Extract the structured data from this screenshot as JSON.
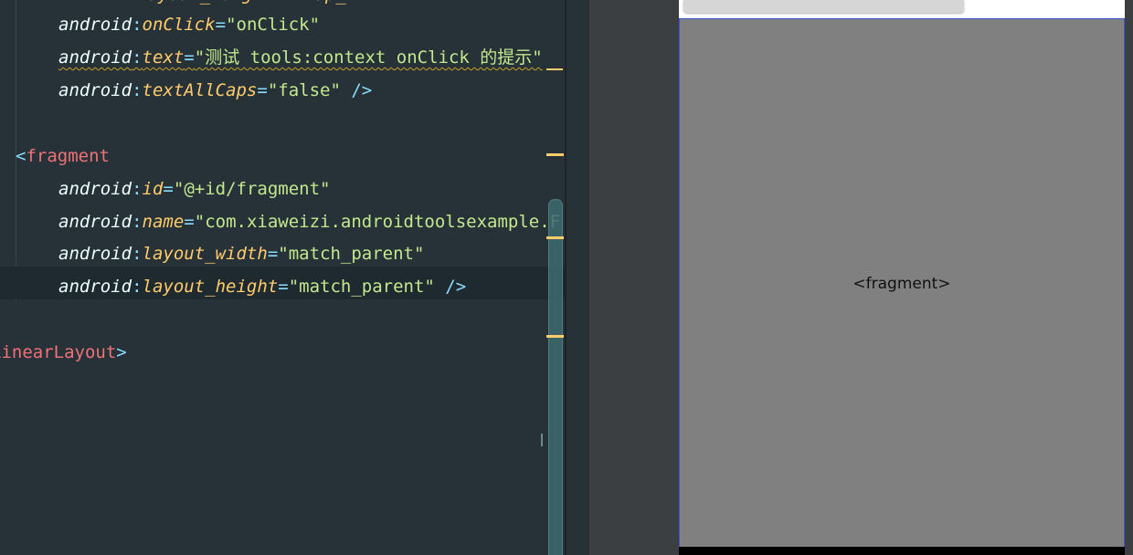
{
  "editor": {
    "partial_top": "layout_height=\"wrap_",
    "lines": [
      {
        "ns": "android",
        "attr": "onClick",
        "value": "\"onClick\"",
        "tail": ""
      },
      {
        "ns": "android",
        "attr": "text",
        "value": "\"测试 tools:context onClick 的提示\"",
        "tail": ""
      },
      {
        "ns": "android",
        "attr": "textAllCaps",
        "value": "\"false\"",
        "tail": " />"
      },
      {
        "open_bracket": "<",
        "tag": "fragment"
      },
      {
        "ns": "android",
        "attr": "id",
        "value": "\"@+id/fragment\"",
        "tail": ""
      },
      {
        "ns": "android",
        "attr": "name",
        "value": "\"com.xiaweizi.androidtoolsexample.F",
        "tail": ""
      },
      {
        "ns": "android",
        "attr": "layout_width",
        "value": "\"match_parent\"",
        "tail": ""
      },
      {
        "ns": "android",
        "attr": "layout_height",
        "value": "\"match_parent\"",
        "tail": " />"
      },
      {
        "tag": "LinearLayout",
        "close_bracket": ">"
      }
    ]
  },
  "preview": {
    "fragment_label": "<fragment>"
  },
  "colors": {
    "editor_bg": "#263238",
    "attribute": "#ffcb6b",
    "string": "#c3e88d",
    "tag": "#f07178",
    "punctuation": "#89ddff",
    "fragment_bg": "#808080",
    "selection_border": "#3f51d8"
  }
}
